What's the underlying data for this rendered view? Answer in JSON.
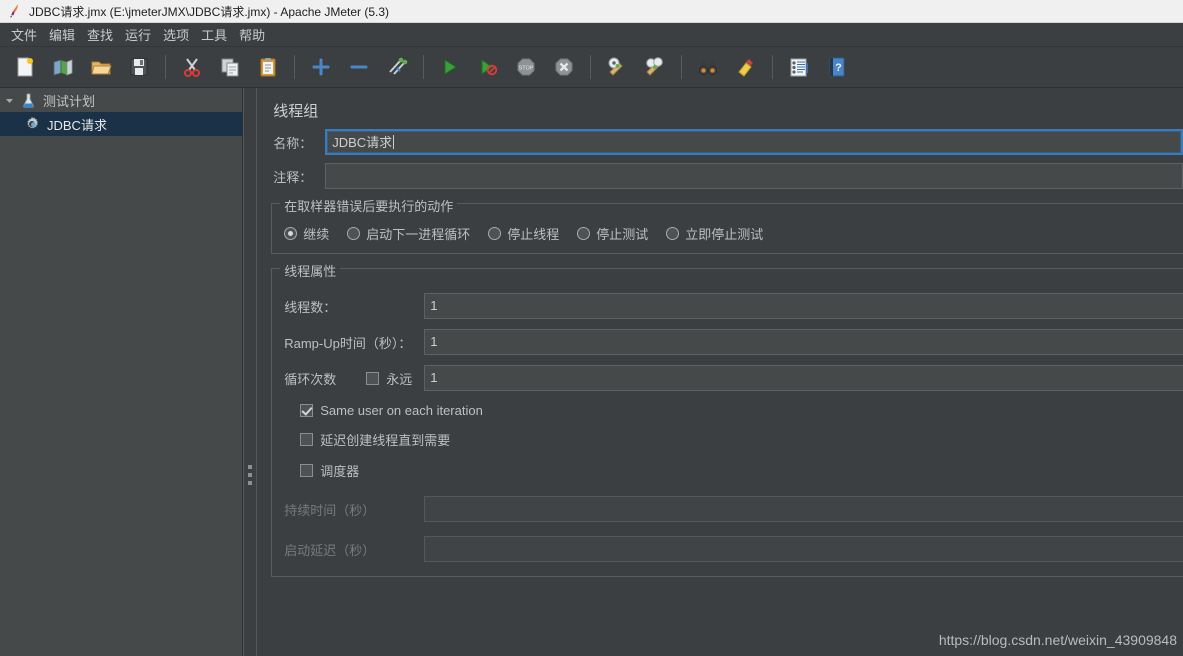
{
  "window": {
    "title": "JDBC请求.jmx (E:\\jmeterJMX\\JDBC请求.jmx) - Apache JMeter (5.3)",
    "app_icon": "jmeter-feather-icon"
  },
  "menubar": {
    "items": [
      {
        "label": "文件",
        "name": "menu-file"
      },
      {
        "label": "编辑",
        "name": "menu-edit"
      },
      {
        "label": "查找",
        "name": "menu-search"
      },
      {
        "label": "运行",
        "name": "menu-run"
      },
      {
        "label": "选项",
        "name": "menu-options"
      },
      {
        "label": "工具",
        "name": "menu-tools"
      },
      {
        "label": "帮助",
        "name": "menu-help"
      }
    ]
  },
  "toolbar": {
    "buttons": [
      {
        "icon": "new-document-icon"
      },
      {
        "icon": "templates-icon"
      },
      {
        "icon": "open-folder-icon"
      },
      {
        "icon": "save-icon"
      },
      {
        "sep": true
      },
      {
        "icon": "cut-scissors-icon"
      },
      {
        "icon": "copy-icon"
      },
      {
        "icon": "paste-clipboard-icon"
      },
      {
        "sep": true
      },
      {
        "icon": "expand-plus-icon"
      },
      {
        "icon": "collapse-minus-icon"
      },
      {
        "icon": "toggle-enable-icon"
      },
      {
        "sep": true
      },
      {
        "icon": "start-play-icon"
      },
      {
        "icon": "start-no-timers-icon"
      },
      {
        "icon": "stop-icon"
      },
      {
        "icon": "shutdown-icon"
      },
      {
        "sep": true
      },
      {
        "icon": "clear-icon"
      },
      {
        "icon": "clear-all-icon"
      },
      {
        "sep": true
      },
      {
        "icon": "search-binoculars-icon"
      },
      {
        "icon": "reset-search-broom-icon"
      },
      {
        "sep": true
      },
      {
        "icon": "function-helper-icon"
      },
      {
        "icon": "help-book-icon"
      }
    ]
  },
  "tree": {
    "nodes": [
      {
        "label": "测试计划",
        "icon": "test-plan-icon",
        "name": "tree-node-test-plan",
        "level": 0,
        "expanded": true,
        "selected": false
      },
      {
        "label": "JDBC请求",
        "icon": "thread-group-gear-icon",
        "name": "tree-node-jdbc-request",
        "level": 1,
        "expanded": false,
        "selected": true
      }
    ]
  },
  "panel": {
    "title": "线程组",
    "name_label": "名称：",
    "name_value": "JDBC请求",
    "comment_label": "注释：",
    "comment_value": "",
    "error_action": {
      "group_title": "在取样器错误后要执行的动作",
      "options": [
        {
          "label": "继续",
          "checked": true,
          "name": "radio-continue"
        },
        {
          "label": "启动下一进程循环",
          "checked": false,
          "name": "radio-start-next-loop"
        },
        {
          "label": "停止线程",
          "checked": false,
          "name": "radio-stop-thread"
        },
        {
          "label": "停止测试",
          "checked": false,
          "name": "radio-stop-test"
        },
        {
          "label": "立即停止测试",
          "checked": false,
          "name": "radio-stop-test-now"
        }
      ]
    },
    "thread_properties": {
      "group_title": "线程属性",
      "threads_label": "线程数：",
      "threads_value": "1",
      "rampup_label": "Ramp-Up时间（秒）：",
      "rampup_value": "1",
      "loops_label": "循环次数",
      "loops_forever_label": "永远",
      "loops_forever_checked": false,
      "loops_value": "1",
      "same_user_label": "Same user on each iteration",
      "same_user_checked": true,
      "delayed_start_label": "延迟创建线程直到需要",
      "delayed_start_checked": false,
      "scheduler_label": "调度器",
      "scheduler_checked": false,
      "duration_label": "持续时间（秒）",
      "duration_value": "",
      "duration_disabled": true,
      "startup_delay_label": "启动延迟（秒）",
      "startup_delay_value": "",
      "startup_delay_disabled": true
    }
  },
  "watermark": "https://blog.csdn.net/weixin_43909848",
  "colors": {
    "window_bg": "#3c3f41",
    "titlebar_bg": "#f0f0f0",
    "tree_bg": "#45494a",
    "tree_selected": "#1b3147",
    "field_bg": "#45494a",
    "focus_border": "#3d7ab8",
    "text": "#bdbfc1"
  }
}
